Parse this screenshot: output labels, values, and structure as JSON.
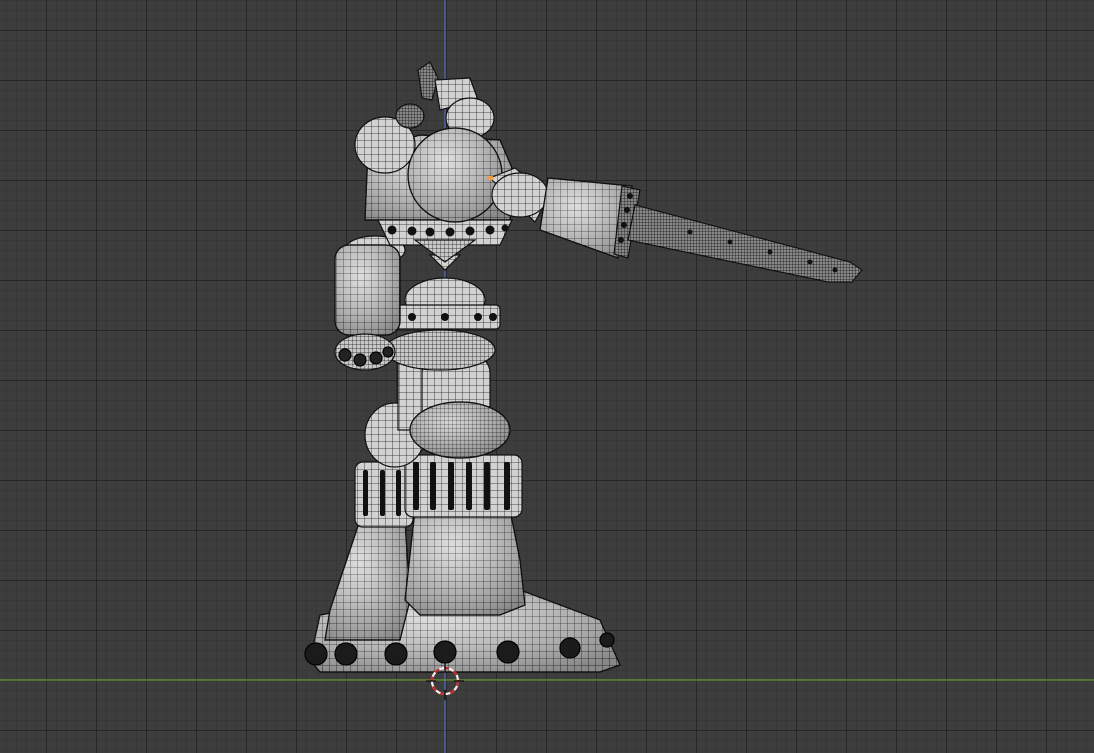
{
  "viewport": {
    "mode": "wireframe",
    "view": "front",
    "background_color": "#3d3d3d",
    "grid_color": "#2b2b2b",
    "axis_x_color": "#6f9a2e",
    "axis_z_color": "#4b6fc2"
  },
  "model": {
    "object_type": "robot",
    "wire_color": "#1a1a1a",
    "fill_color": "#d8d8d8",
    "rivet_color": "#1b1b1b",
    "selected_vertex_color": "#ff9a2a"
  },
  "cursor": {
    "icon": "3d-cursor-icon",
    "ring_color": "#cc2222"
  }
}
